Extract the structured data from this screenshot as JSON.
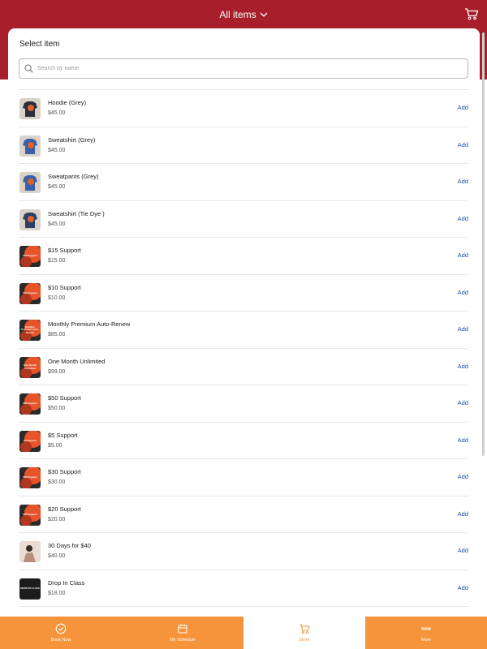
{
  "header": {
    "title": "All items",
    "cart_icon": "cart-icon",
    "bg_color": "#a61f2a"
  },
  "panel": {
    "title": "Select item",
    "search_placeholder": "Search by name"
  },
  "items": [
    {
      "name": "Hoodie (Grey)",
      "price": "$45.00",
      "add": "Add",
      "thumb": "apparel",
      "thumb_text": ""
    },
    {
      "name": "Sweatshirt (Grey)",
      "price": "$45.00",
      "add": "Add",
      "thumb": "apparel",
      "thumb_text": ""
    },
    {
      "name": "Sweatpants (Grey)",
      "price": "$45.00",
      "add": "Add",
      "thumb": "apparel",
      "thumb_text": ""
    },
    {
      "name": "Sweatshirt (Tie Dye )",
      "price": "$45.00",
      "add": "Add",
      "thumb": "apparel",
      "thumb_text": ""
    },
    {
      "name": "$15 Support",
      "price": "$15.00",
      "add": "Add",
      "thumb": "graphic",
      "thumb_text": "$15 Support"
    },
    {
      "name": "$10 Support",
      "price": "$10.00",
      "add": "Add",
      "thumb": "graphic",
      "thumb_text": "$10 Support"
    },
    {
      "name": "Monthly Premium Auto-Renew",
      "price": "$85.00",
      "add": "Add",
      "thumb": "graphic",
      "thumb_text": "Monthly Premium Auto-Renew"
    },
    {
      "name": "One Month Unlimited",
      "price": "$99.00",
      "add": "Add",
      "thumb": "graphic",
      "thumb_text": "One Month Unlimited"
    },
    {
      "name": "$50 Support",
      "price": "$50.00",
      "add": "Add",
      "thumb": "graphic",
      "thumb_text": "$50 Support"
    },
    {
      "name": "$5 Support",
      "price": "$5.00",
      "add": "Add",
      "thumb": "graphic",
      "thumb_text": "$5 Support"
    },
    {
      "name": "$30 Support",
      "price": "$30.00",
      "add": "Add",
      "thumb": "graphic",
      "thumb_text": "$30 Support"
    },
    {
      "name": "$20 Support",
      "price": "$20.00",
      "add": "Add",
      "thumb": "graphic",
      "thumb_text": "$20 Support"
    },
    {
      "name": "30 Days for $40",
      "price": "$40.00",
      "add": "Add",
      "thumb": "photo",
      "thumb_text": ""
    },
    {
      "name": "Drop In Class",
      "price": "$18.00",
      "add": "Add",
      "thumb": "dark",
      "thumb_text": "DROP IN CLASS"
    }
  ],
  "tabbar": {
    "accent": "#f5943a",
    "tabs": [
      {
        "label": "Book Now",
        "icon": "check-circle-icon",
        "active": false
      },
      {
        "label": "My Schedule",
        "icon": "calendar-icon",
        "active": false
      },
      {
        "label": "Store",
        "icon": "cart-icon",
        "active": true
      },
      {
        "label": "More",
        "icon": "more-dots-icon",
        "active": false
      }
    ]
  }
}
